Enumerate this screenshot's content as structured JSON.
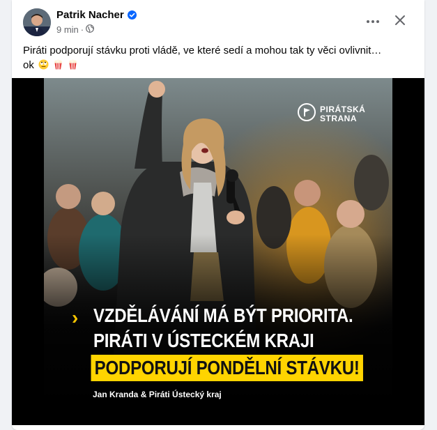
{
  "post": {
    "author": "Patrik Nacher",
    "time": "9 min",
    "separator": "·",
    "text_line1": "Piráti podporují stávku proti vládě, ve které sedí a mohou tak ty věci ovlivnit…",
    "text_line2": "ok",
    "emojis": [
      "rolling-eyes-emoji",
      "popcorn-emoji",
      "popcorn-emoji"
    ]
  },
  "header_icons": {
    "audience": "globe-icon",
    "verified": "verified-badge-icon",
    "more": "more-options-icon",
    "close": "close-icon"
  },
  "image": {
    "logo_line1": "PIRÁTSKÁ",
    "logo_line2": "STRANA",
    "headline_line1": "VZDĚLÁVÁNÍ MÁ BÝT PRIORITA.",
    "headline_line2": "PIRÁTI V ÚSTECKÉM KRAJI",
    "headline_line3": "PODPORUJÍ PONDĚLNÍ STÁVKU!",
    "credit": "Jan Kranda & Piráti Ústecký kraj",
    "arrow_glyph": "›"
  },
  "colors": {
    "accent_yellow": "#ffd400",
    "verified_blue": "#0866ff",
    "meta_gray": "#65676b"
  }
}
